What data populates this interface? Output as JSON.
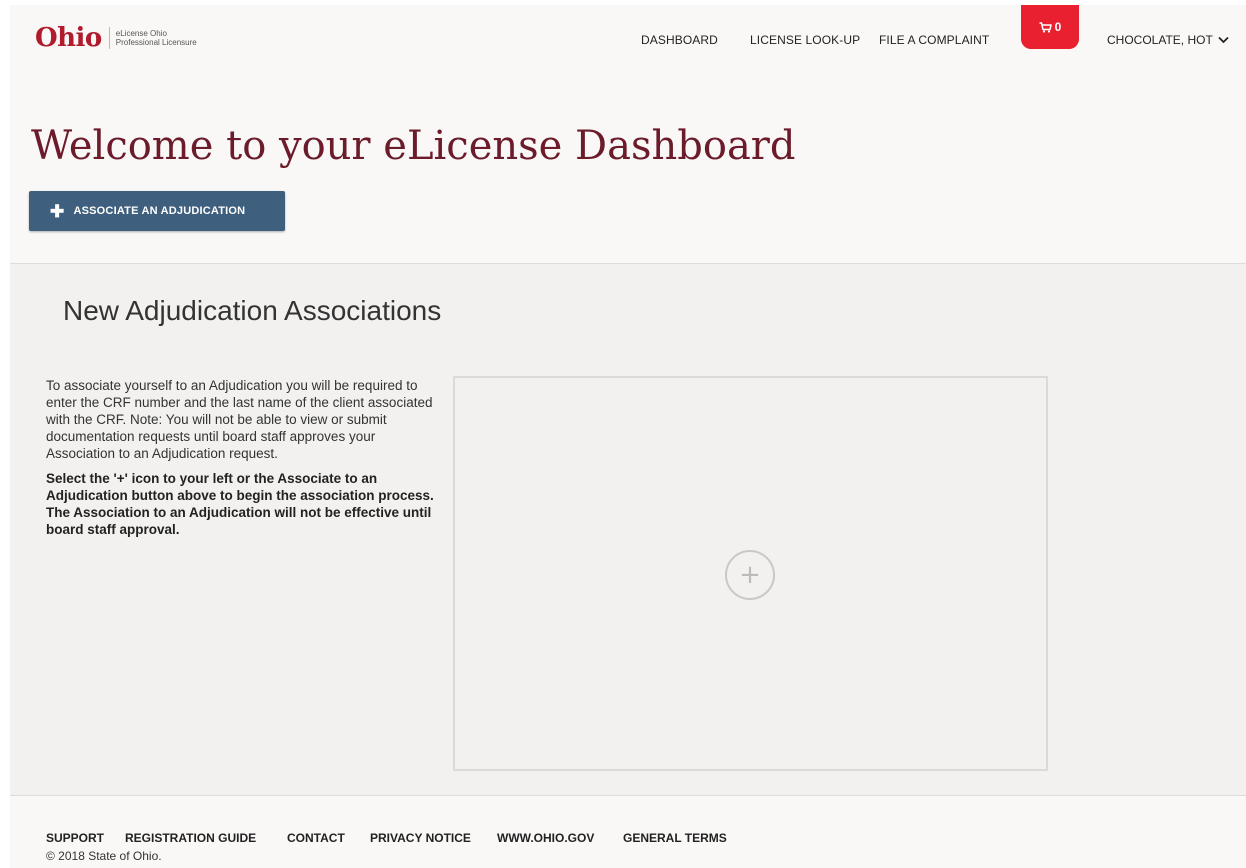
{
  "header": {
    "logo_text": "Ohio",
    "logo_sub_line1": "eLicense Ohio",
    "logo_sub_line2": "Professional Licensure",
    "nav": [
      {
        "label": "DASHBOARD"
      },
      {
        "label": "LICENSE LOOK-UP"
      },
      {
        "label": "FILE A COMPLAINT"
      }
    ],
    "cart_count": "0",
    "user_name": "CHOCOLATE, HOT",
    "accent_color": "#e8202f",
    "icons": {
      "cart": "cart-icon",
      "user_menu": "chevron-down-icon"
    }
  },
  "main": {
    "title": "Welcome to your eLicense Dashboard",
    "associate_button_label": "ASSOCIATE AN ADJUDICATION",
    "title_color": "#6b1b2a",
    "button_color": "#3f5f7e"
  },
  "section": {
    "title": "New Adjudication Associations",
    "description": "To associate yourself to an Adjudication you will be required to enter the CRF number and the last name of the client associated with the CRF. Note: You will not be able to view or submit documentation requests until board staff approves your Association to an Adjudication request.",
    "instruction": "Select the '+' icon to your left or the Associate to an Adjudication button above to begin the association process. The Association to an Adjudication will not be effective until board staff approval.",
    "add_icon": "plus-circle-icon"
  },
  "footer": {
    "links": [
      {
        "label": "SUPPORT"
      },
      {
        "label": "REGISTRATION GUIDE"
      },
      {
        "label": "CONTACT"
      },
      {
        "label": "PRIVACY NOTICE"
      },
      {
        "label": "WWW.OHIO.GOV"
      },
      {
        "label": "GENERAL TERMS"
      }
    ],
    "copyright": "© 2018 State of Ohio."
  }
}
